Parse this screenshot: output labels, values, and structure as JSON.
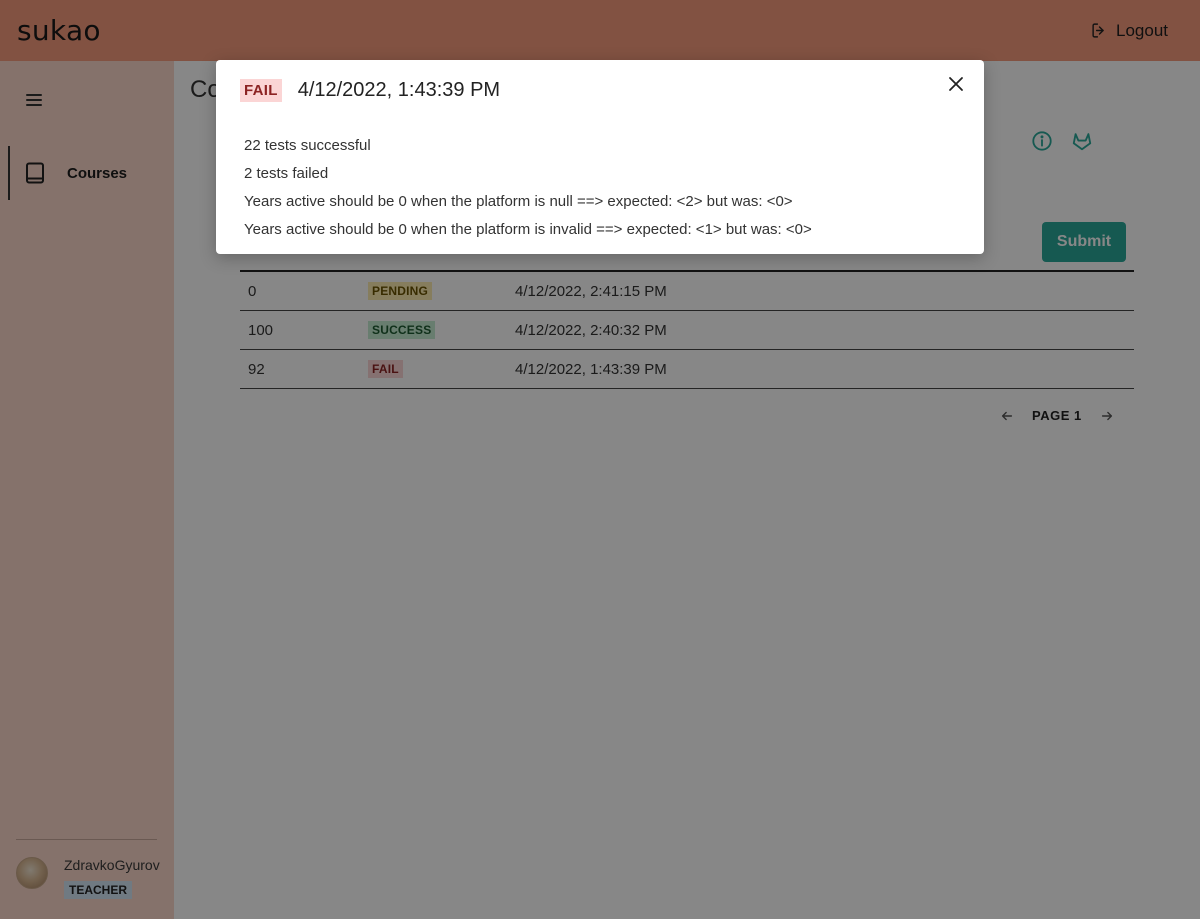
{
  "header": {
    "logo": "sukao",
    "logout_label": "Logout"
  },
  "sidebar": {
    "menu_icon": "hamburger-icon",
    "items": [
      {
        "label": "Courses",
        "icon": "book-icon",
        "active": true
      }
    ],
    "user": {
      "name": "ZdravkoGyurov",
      "role": "TEACHER"
    }
  },
  "main": {
    "title": "Co",
    "action_icons": [
      "info-icon",
      "gitlab-icon"
    ],
    "submit_label": "Submit",
    "submissions": [
      {
        "score": "0",
        "status": "PENDING",
        "date": "4/12/2022, 2:41:15 PM"
      },
      {
        "score": "100",
        "status": "SUCCESS",
        "date": "4/12/2022, 2:40:32 PM"
      },
      {
        "score": "92",
        "status": "FAIL",
        "date": "4/12/2022, 1:43:39 PM"
      }
    ],
    "pagination": {
      "label": "PAGE 1"
    }
  },
  "modal": {
    "status": "FAIL",
    "title": "4/12/2022, 1:43:39 PM",
    "lines": [
      "22 tests successful",
      "2 tests failed",
      "Years active should be 0 when the platform is null ==> expected: <2> but was: <0>",
      "Years active should be 0 when the platform is invalid ==> expected: <1> but was: <0>"
    ]
  },
  "colors": {
    "header": "#f59c7e",
    "sidebar": "#fbd8cb",
    "submit": "#2aa89a",
    "fail_bg": "#fbd5d5",
    "success_bg": "#c5ecd1",
    "pending_bg": "#fdedb0"
  }
}
